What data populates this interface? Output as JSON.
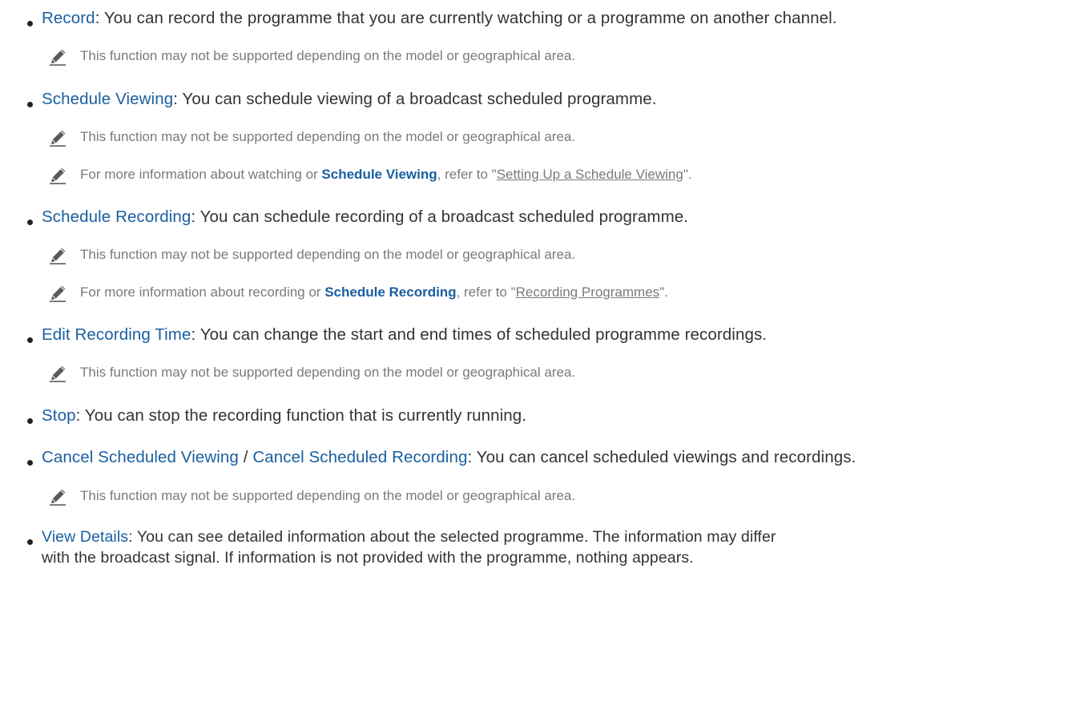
{
  "items": [
    {
      "term": "Record",
      "desc": ": You can record the programme that you are currently watching or a programme on another channel."
    },
    {
      "term": "Schedule Viewing",
      "desc": ": You can schedule viewing of a broadcast scheduled programme."
    },
    {
      "term": "Schedule Recording",
      "desc": ": You can schedule recording of a broadcast scheduled programme."
    },
    {
      "term": "Edit Recording Time",
      "desc": ": You can change the start and end times of scheduled programme recordings."
    },
    {
      "term": "Stop",
      "desc": ": You can stop the recording function that is currently running."
    },
    {
      "term": "Cancel Scheduled Viewing",
      "sep": " / ",
      "term2": "Cancel Scheduled Recording",
      "desc": ": You can cancel scheduled viewings and recordings."
    },
    {
      "term": "View Details",
      "desc": ": You can see detailed information about the selected programme. The information may differ",
      "desc2": "with the broadcast signal. If information is not provided with the programme, nothing appears."
    }
  ],
  "notes": {
    "not_supported": "This function may not be supported depending on the model or geographical area.",
    "viewing_pre": "For more information about watching or ",
    "viewing_term": "Schedule Viewing",
    "viewing_mid": ", refer to \"",
    "viewing_link": "Setting Up a Schedule Viewing",
    "viewing_post": "\".",
    "recording_pre": "For more information about recording or ",
    "recording_term": "Schedule Recording",
    "recording_mid": ", refer to \"",
    "recording_link": "Recording Programmes",
    "recording_post": "\"."
  },
  "icons": {
    "note": "pencil-icon"
  },
  "colors": {
    "term": "#1a5fa0",
    "note_text": "#7a7a7a",
    "body_text": "#333333"
  }
}
